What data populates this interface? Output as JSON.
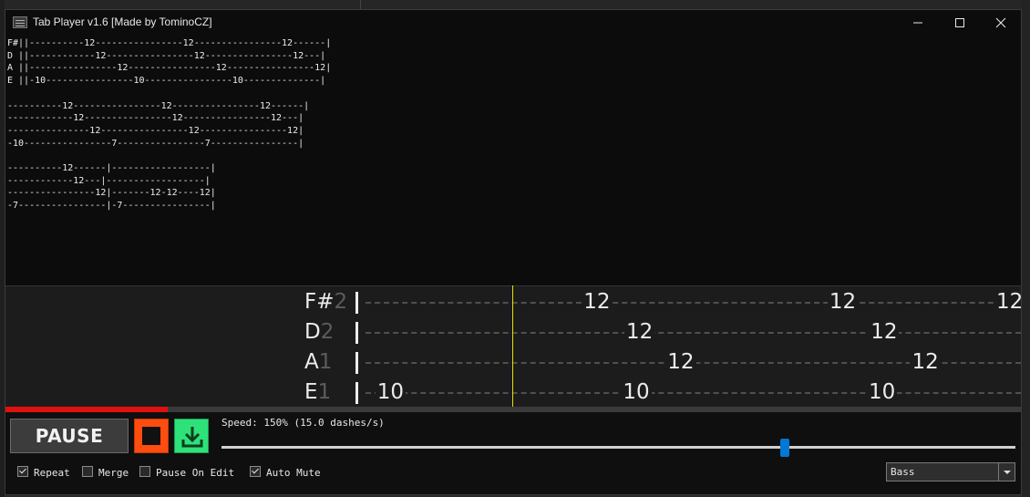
{
  "window": {
    "title": "Tab Player v1.6 [Made by TominoCZ]"
  },
  "tab_text": "F#||----------12----------------12----------------12------|\nD ||------------12----------------12----------------12---|\nA ||----------------12----------------12----------------12|\nE ||-10----------------10----------------10--------------|\n\n----------12----------------12----------------12------|\n------------12----------------12----------------12---|\n---------------12----------------12----------------12|\n-10----------------7----------------7----------------|\n\n----------12------|------------------|\n------------12---|------------------|\n----------------12|-------12-12----12|\n-7----------------|-7----------------|",
  "viewer": {
    "strings": [
      {
        "name": "F#",
        "octave": "2",
        "notes": [
          {
            "fret": "12",
            "pos": 0.33
          },
          {
            "fret": "12",
            "pos": 0.705
          },
          {
            "fret": "12",
            "pos": 1.0
          }
        ]
      },
      {
        "name": "D",
        "octave": "2",
        "notes": [
          {
            "fret": "12",
            "pos": 0.395
          },
          {
            "fret": "12",
            "pos": 0.768
          }
        ]
      },
      {
        "name": "A",
        "octave": "1",
        "notes": [
          {
            "fret": "12",
            "pos": 0.458
          },
          {
            "fret": "12",
            "pos": 0.831
          }
        ]
      },
      {
        "name": "E",
        "octave": "1",
        "notes": [
          {
            "fret": "10",
            "pos": 0.015
          },
          {
            "fret": "10",
            "pos": 0.39
          },
          {
            "fret": "10",
            "pos": 0.765
          }
        ]
      }
    ],
    "cursor_color": "#e4e000"
  },
  "progress": {
    "value": 0.16,
    "color": "#e01010"
  },
  "controls": {
    "pause_label": "PAUSE",
    "stop_color": "#ff4d10",
    "download_color": "#2ee27a",
    "speed_text": "Speed: 150% (15.0 dashes/s)",
    "speed_slider_value": 0.71,
    "slider_color": "#0078d4",
    "checkboxes": [
      {
        "label": "Repeat",
        "checked": true
      },
      {
        "label": "Merge",
        "checked": false
      },
      {
        "label": "Pause On Edit",
        "checked": false
      },
      {
        "label": "Auto Mute",
        "checked": true
      }
    ],
    "instrument": "Bass"
  },
  "icons": [
    "app-icon",
    "minimize-icon",
    "maximize-icon",
    "close-icon",
    "stop-icon",
    "download-icon",
    "chevron-down-icon"
  ]
}
